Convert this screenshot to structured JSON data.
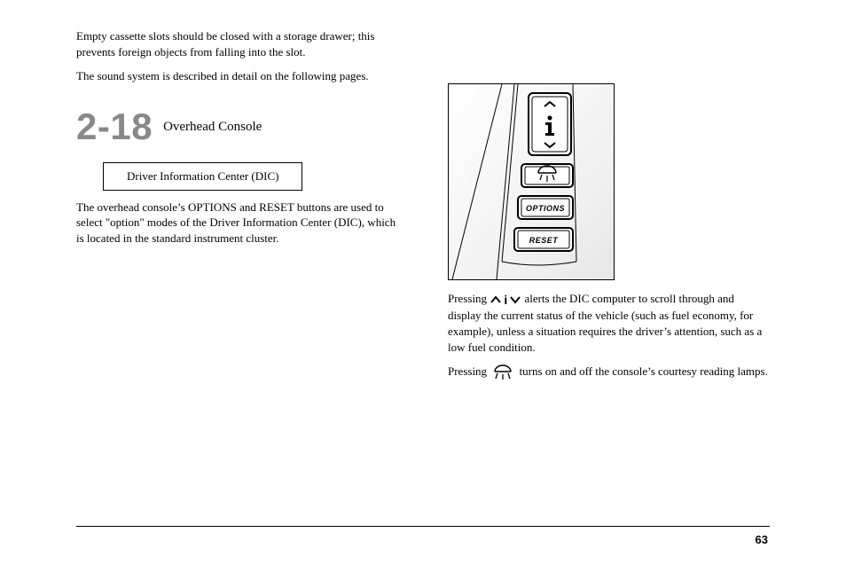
{
  "left": {
    "para1": "Empty cassette slots should be closed with a storage drawer; this prevents foreign objects from falling into the slot.",
    "para2": "The sound system is described in detail on the following pages.",
    "sectionNumber": "2-18",
    "sectionTitle": "Overhead Console",
    "subheadBox": "Driver Information Center (DIC)",
    "para3": "The overhead console’s OPTIONS and RESET buttons are used to select \"option\" modes of the Driver Information Center (DIC), which is located in the standard instrument cluster."
  },
  "right": {
    "panel": {
      "options": "OPTIONS",
      "reset": "RESET"
    },
    "info_prefix": "Pressing",
    "info_suffix": "alerts the DIC computer to scroll through and display the current status of the vehicle (such as fuel economy, for example), unless a situation requires the driver’s attention, such as a low fuel condition.",
    "bulb_prefix": "Pressing",
    "bulb_suffix": "turns on and off the console’s courtesy reading lamps."
  },
  "footer": {
    "pageNumber": "63"
  },
  "icons": {
    "info": "info-nav-icon",
    "bulb": "bulb-icon"
  }
}
